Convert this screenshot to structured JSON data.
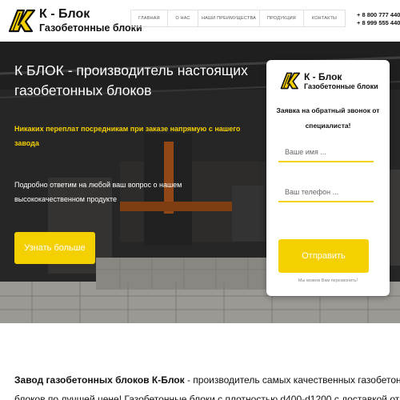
{
  "brand": {
    "title": "К - Блок",
    "subtitle": "Газобетонные блоки",
    "accent": "#f5d000"
  },
  "nav": {
    "items": [
      {
        "label": "Главная"
      },
      {
        "label": "О нас"
      },
      {
        "label": "Наши преимущества"
      },
      {
        "label": "Продукция"
      },
      {
        "label": "Контакты"
      }
    ]
  },
  "phones": [
    "+ 8 800 777 440",
    "+ 8 999 555 440"
  ],
  "hero": {
    "title": "К БЛОК - производитель настоящих газобетонных блоков",
    "accent_text": "Никаких переплат посредникам при заказе напрямую с нашего завода",
    "text": "Подробно ответим на любой ваш вопрос о нашем высококачественном продукте",
    "button_label": "Узнать больше"
  },
  "form": {
    "heading": "Заявка на обратный звонок от специалиста!",
    "name_placeholder": "Ваше имя ...",
    "phone_placeholder": "Ваш телефон ...",
    "submit_label": "Отправить",
    "note": "Мы можем Вам перезвонить!"
  },
  "about": {
    "lead": "Завод газобетонных блоков К-Блок",
    "line1_rest": " - производитель самых качественных газобетонных",
    "line2": "блоков по лучшей цене! Газобетонные блоки с плотностью d400-d1200 с доставкой от"
  }
}
